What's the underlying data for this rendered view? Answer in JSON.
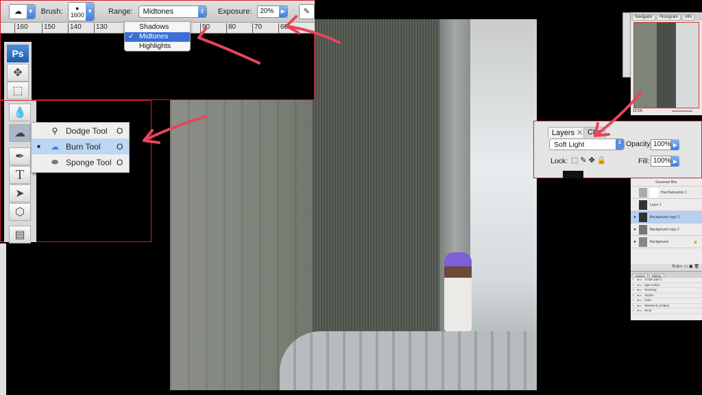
{
  "options_bar": {
    "brush_label": "Brush:",
    "brush_size": "1600",
    "range_label": "Range:",
    "range_value": "Midtones",
    "exposure_label": "Exposure:",
    "exposure_value": "20%"
  },
  "range_menu": {
    "options": [
      "Shadows",
      "Midtones",
      "Highlights"
    ],
    "selected": "Midtones"
  },
  "ruler": {
    "ticks": [
      "160",
      "150",
      "140",
      "130",
      "90",
      "80",
      "70",
      "60"
    ]
  },
  "toolbox": {
    "logo": "Ps"
  },
  "tool_flyout": {
    "items": [
      {
        "label": "Dodge Tool",
        "key": "O"
      },
      {
        "label": "Burn Tool",
        "key": "O",
        "selected": true
      },
      {
        "label": "Sponge Tool",
        "key": "O"
      }
    ]
  },
  "navigator": {
    "tabs": [
      "Navigator",
      "Histogram",
      "Info"
    ],
    "zoom": "12.5%"
  },
  "layers_panel": {
    "tabs": [
      "Layers",
      "Cha"
    ],
    "blend_mode": "Soft Light",
    "opacity_label": "Opacity:",
    "opacity": "100%",
    "lock_label": "Lock:",
    "fill_label": "Fill:",
    "fill": "100%",
    "layers": [
      {
        "name": "Gaussian Blur"
      },
      {
        "name": "Hue/Saturation 1"
      },
      {
        "name": "Layer 1"
      },
      {
        "name": "Background copy 3",
        "selected": true
      },
      {
        "name": "Background copy 2"
      },
      {
        "name": "Background"
      }
    ]
  },
  "actions_panel": {
    "tabs": [
      "Actions",
      "History"
    ],
    "items": [
      "Action part 1",
      "type action",
      "Resizing",
      "Stylize",
      "tests",
      "Weekend_Galpao",
      "temp"
    ]
  },
  "colors": {
    "annotation": "#e8455a",
    "highlight": "#3b6fd8"
  }
}
